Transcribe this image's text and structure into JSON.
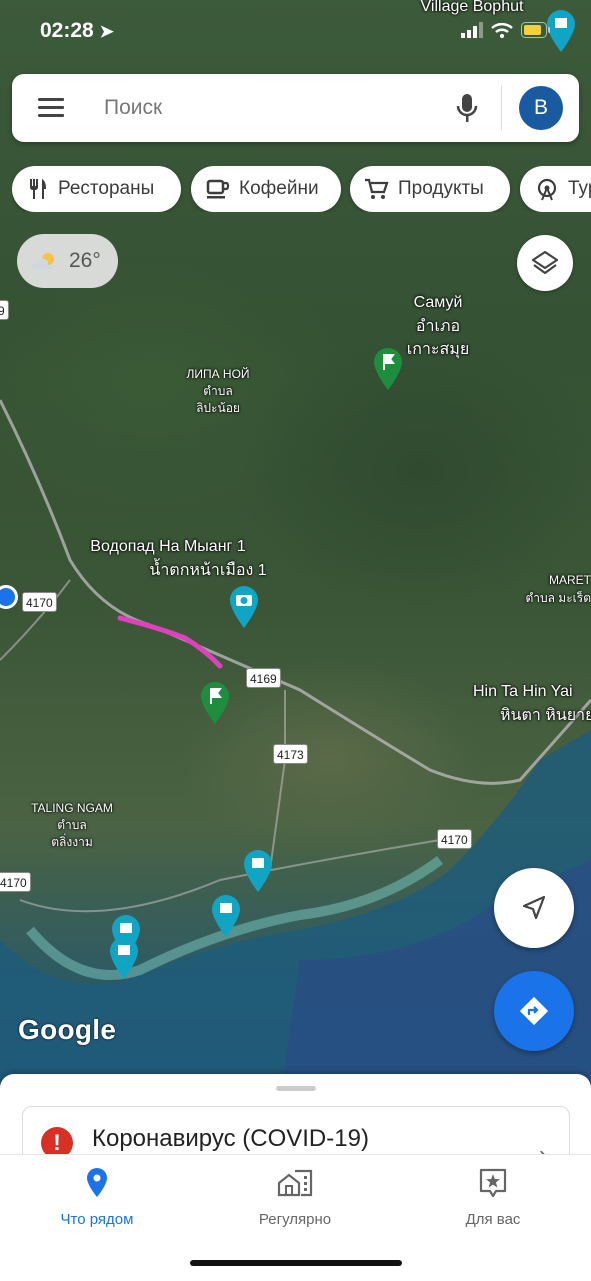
{
  "status_bar": {
    "time": "02:28"
  },
  "search": {
    "placeholder": "Поиск",
    "avatar_letter": "B"
  },
  "chips": [
    {
      "label": "Рестораны",
      "icon": "restaurant-icon"
    },
    {
      "label": "Кофейни",
      "icon": "coffee-icon"
    },
    {
      "label": "Продукты",
      "icon": "cart-icon"
    },
    {
      "label": "Тур",
      "icon": "attractions-icon"
    }
  ],
  "weather": {
    "temp": "26°",
    "icon": "partly-cloudy-icon"
  },
  "map_labels": {
    "village_bophut": "Village Bophut",
    "samui_ru": "Самуй",
    "samui_th1": "อำเภอ",
    "samui_th2": "เกาะสมุย",
    "lipa_noi_ru": "ЛИПА НОЙ",
    "lipa_noi_th1": "ตำบล",
    "lipa_noi_th2": "ลิปะน้อย",
    "waterfall_ru": "Водопад На Мыанг 1",
    "waterfall_th": "น้ำตกหน้าเมือง 1",
    "maret": "MARET",
    "maret_th": "ตำบล มะเร็ต",
    "hin_ta_en": "Hin Ta Hin Yai",
    "hin_ta_th": "หินตา หินยาย",
    "taling_ngam": "TALING NGAM",
    "taling_th1": "ตำบล",
    "taling_th2": "ตลิ่งงาม",
    "road_4170_a": "4170",
    "road_4169": "4169",
    "road_4173": "4173",
    "road_4170_b": "4170",
    "road_4170_c": "4170",
    "road_9": "9",
    "attribution": "Google"
  },
  "covid_card": {
    "title": "Коронавирус (COVID-19)"
  },
  "bottom_nav": [
    {
      "label": "Что рядом",
      "icon": "location-pin-icon",
      "active": true
    },
    {
      "label": "Регулярно",
      "icon": "commute-icon",
      "active": false
    },
    {
      "label": "Для вас",
      "icon": "for-you-icon",
      "active": false
    }
  ],
  "colors": {
    "accent": "#1a73e8",
    "route": "#e040c0",
    "pin_green": "#1e8e3e",
    "pin_teal": "#12a4c4"
  }
}
